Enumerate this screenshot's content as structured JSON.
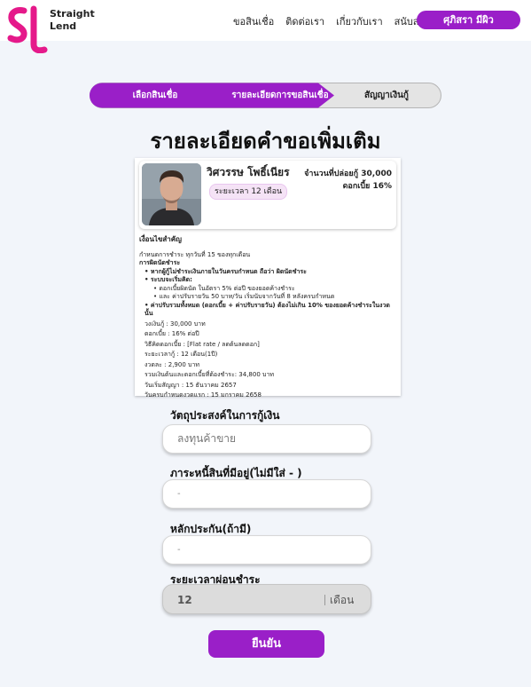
{
  "header": {
    "logo_text": "SL",
    "brand_line1": "Straight",
    "brand_line2": "Lend",
    "nav": [
      "ขอสินเชื่อ",
      "ติดต่อเรา",
      "เกี่ยวกับเรา",
      "สนับสนุน"
    ],
    "user_button": "ศุภิสรา มีผิว"
  },
  "stepper": {
    "steps": [
      "เลือกสินเชื่อ",
      "รายละเอียดการขอสินเชื่อ",
      "สัญญาเงินกู้"
    ],
    "active_step": 2
  },
  "page_title": "รายละเอียดคำขอเพิ่มเติม",
  "profile": {
    "name": "วิศวรรษ โพธิ์เนียร",
    "term_badge": "ระยะเวลา 12 เดือน",
    "amount_line": "จำนวนที่ปล่อยกู้ 30,000",
    "rate_line": "ดอกเบี้ย 16%"
  },
  "terms": {
    "heading": "เงื่อนไขสำคัญ",
    "payment_schedule": "กำหนดการชำระ ทุกวันที่ 15 ของทุกเดือน",
    "default_title": "การผิดนัดชำระ",
    "default_bullet": "หากผู้กู้ไม่ชำระเงินภายในวันครบกำหนด ถือว่า ผิดนัดชำระ",
    "penalty_title": "ระบบจะเริ่มคิด:",
    "penalty_1": "ดอกเบี้ยผิดนัด ในอัตรา 5% ต่อปี ของยอดค้างชำระ",
    "penalty_2": "และ ค่าปรับรายวัน 50 บาท/วัน เริ่มนับจากวันที่ 8 หลังครบกำหนด",
    "cap": "ค่าปรับรวมทั้งหมด (ดอกเบี้ย + ค่าปรับรายวัน) ต้องไม่เกิน 10% ของยอดค้างชำระในงวดนั้น",
    "principal": "วงเงินกู้ :    30,000 บาท",
    "interest": "ดอกเบี้ย :    16% ต่อปี",
    "method": "วิธีคิดดอกเบี้ย :  [Flat rate / ลดต้นลดดอก]",
    "duration": "ระยะเวลากู้ :    12 เดือน(1ปี)",
    "installment": "งวดละ   :       2,900 บาท",
    "total": "รวมเงินต้นและดอกเบี้ยที่ต้องชำระ: 34,800 บาท",
    "start_date": "วันเริ่มสัญญา : 15 ธันวาคม 2657",
    "first_due": "วันครบกำหนดงวดแรก : 15 มกราคม 2658"
  },
  "form": {
    "purpose_label": "วัตถุประสงค์ในการกู้เงิน",
    "purpose_value": "ลงทุนค้าขาย",
    "debt_label": "ภาระหนี้สินที่มีอยู่(ไม่มีใส่ - )",
    "debt_value": "-",
    "collateral_label": "หลักประกัน(ถ้ามี)",
    "collateral_value": "-",
    "duration_label": "ระยะเวลาผ่อนชำระ",
    "duration_value": "12",
    "duration_unit": "เดือน"
  },
  "confirm_button": "ยืนยัน",
  "colors": {
    "brand_pink": "#e5198a",
    "accent_purple": "#9a1fc8",
    "stepper_inactive": "#e4e4e4"
  }
}
